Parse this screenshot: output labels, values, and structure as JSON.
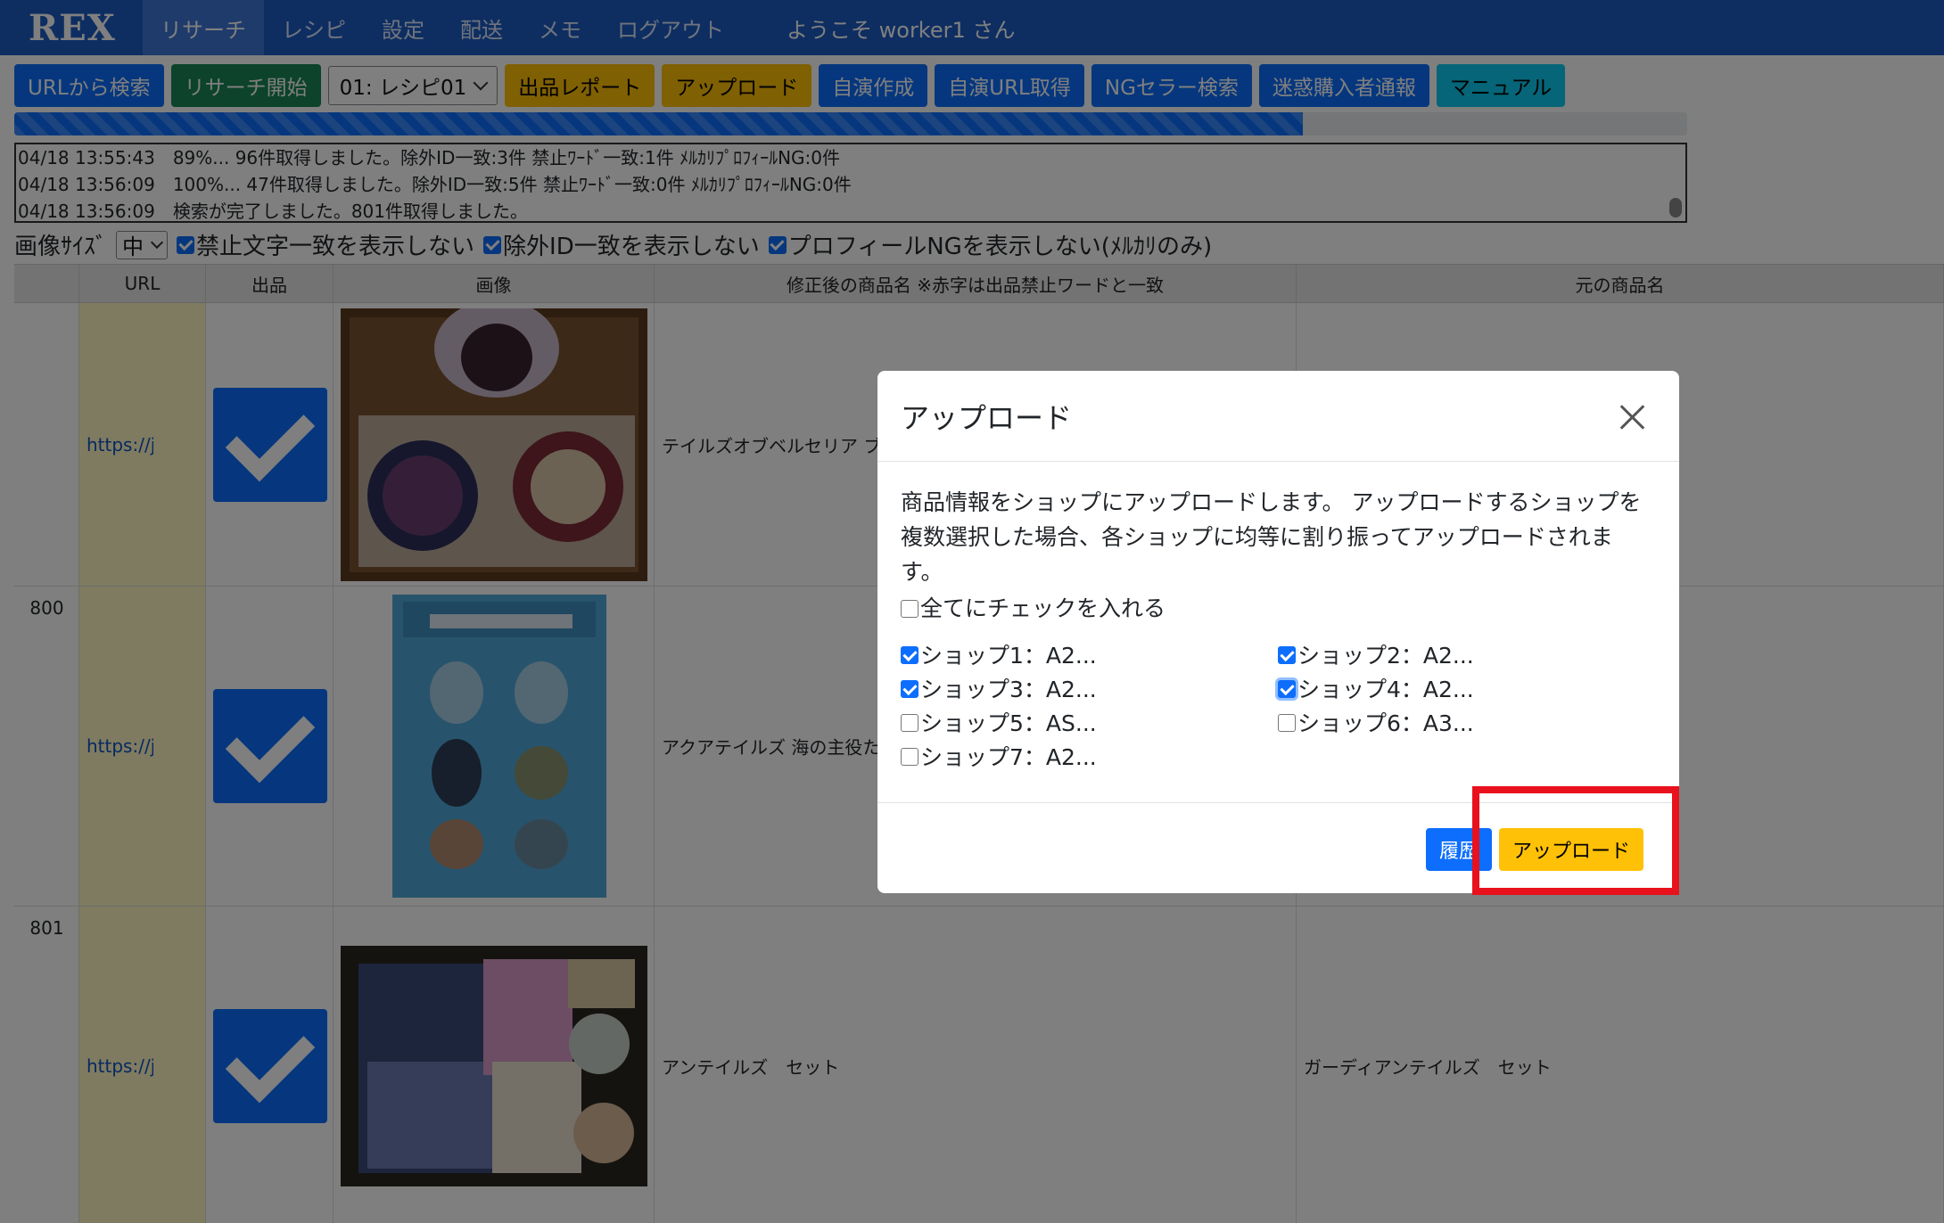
{
  "nav": {
    "brand": "REX",
    "items": [
      "リサーチ",
      "レシピ",
      "設定",
      "配送",
      "メモ",
      "ログアウト"
    ],
    "welcome": "ようこそ worker1 さん"
  },
  "toolbar": {
    "url_search": "URLから検索",
    "research_start": "リサーチ開始",
    "recipe_select": "01: レシピ01",
    "listing_report": "出品レポート",
    "upload": "アップロード",
    "self_create": "自演作成",
    "self_url": "自演URL取得",
    "ng_seller": "NGセラー検索",
    "report_buyer": "迷惑購入者通報",
    "manual": "マニュアル"
  },
  "progress": {
    "value": 0.77
  },
  "log": {
    "lines": [
      "04/18 13:55:43　89%... 96件取得しました。除外ID一致:3件 禁止ﾜｰﾄﾞ一致:1件 ﾒﾙｶﾘﾌﾟﾛﾌｨｰﾙNG:0件",
      "04/18 13:56:09　100%... 47件取得しました。除外ID一致:5件 禁止ﾜｰﾄﾞ一致:0件 ﾒﾙｶﾘﾌﾟﾛﾌｨｰﾙNG:0件",
      "04/18 13:56:09　検索が完了しました。801件取得しました。"
    ]
  },
  "options": {
    "image_size_label": "画像ｻｲｽﾞ",
    "image_size_value": "中",
    "hide_forbidden": "禁止文字一致を表示しない",
    "hide_excluded": "除外ID一致を表示しない",
    "hide_profile_ng": "プロフィールNGを表示しない(ﾒﾙｶﾘのみ)"
  },
  "table": {
    "headers": [
      "",
      "URL",
      "出品",
      "画像",
      "修正後の商品名 ※赤字は出品禁止ワードと一致",
      "元の商品名"
    ],
    "rows": [
      {
        "no": "",
        "url": "https://jp.mercari.com",
        "name": "テイルズオブベルセリア ブ",
        "orig": ""
      },
      {
        "no": "800",
        "url": "https://jp.mercari.com",
        "name": "アクアテイルズ 海の主役た",
        "orig": ""
      },
      {
        "no": "801",
        "url": "https://jp.mercari.com",
        "name": "アンテイルズ　セット",
        "orig": "ガーディアンテイルズ　セット"
      }
    ]
  },
  "modal": {
    "title": "アップロード",
    "description": "商品情報をショップにアップロードします。 アップロードするショップを複数選択した場合、各ショップに均等に割り振ってアップロードされます。",
    "check_all": "全てにチェックを入れる",
    "shops": [
      {
        "label": "ショップ1：A2...",
        "checked": true
      },
      {
        "label": "ショップ2：A2...",
        "checked": true
      },
      {
        "label": "ショップ3：A2...",
        "checked": true
      },
      {
        "label": "ショップ4：A2...",
        "checked": true
      },
      {
        "label": "ショップ5：AS...",
        "checked": false
      },
      {
        "label": "ショップ6：A3...",
        "checked": false
      },
      {
        "label": "ショップ7：A2...",
        "checked": false
      }
    ],
    "history_button": "履歴",
    "upload_button": "アップロード"
  },
  "colors": {
    "navbar": "#1c5cc4",
    "primary": "#0d6efd",
    "warning": "#ffc107",
    "success": "#198754",
    "info": "#0dcaf0",
    "highlight": "#e8111c"
  }
}
